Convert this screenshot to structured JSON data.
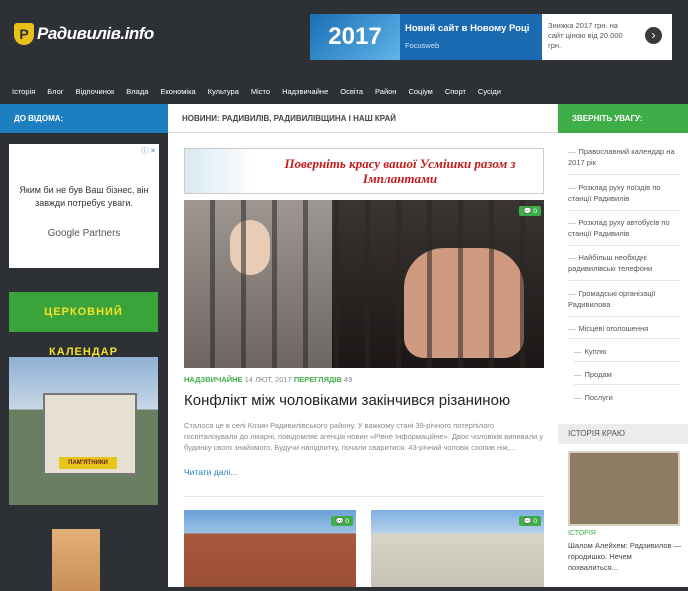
{
  "site": {
    "logo_letter": "Р",
    "logo_text": "Радивилів.info"
  },
  "top_ad": {
    "image_text": "2017",
    "title": "Новий сайт в Новому Році",
    "source": "Focusweb",
    "body": "Знижка 2017 грн. на сайт ціною від 20.000 грн.",
    "arrow": "›"
  },
  "nav": {
    "items": [
      "Історія",
      "Блог",
      "Відпочинок",
      "Влада",
      "Економіка",
      "Культура",
      "Місто",
      "Надзвичайне",
      "Освіта",
      "Район",
      "Соціум",
      "Спорт",
      "Сусіди"
    ]
  },
  "left": {
    "header": "ДО ВІДОМА:",
    "google_ad": {
      "text": "Яким би не був Ваш бізнес, він завжди потребує уваги.",
      "brand": "Google Partners",
      "close": "ⓘ ✕"
    },
    "calendar_banner": "ЦЕРКОВНИЙ КАЛЕНДАР",
    "kiosk_sign": "ПАМ'ЯТНИКИ"
  },
  "main": {
    "header": "НОВИНИ: РАДИВИЛІВ, РАДИВИЛІВЩИНА І НАШ КРАЙ",
    "banner_text": "Поверніть красу вашої Усмішки разом з Імплантами",
    "article": {
      "comments": "0",
      "category": "НАДЗВИЧАЙНЕ",
      "date": "14 ЛЮТ, 2017",
      "views_label": "ПЕРЕГЛЯДІВ",
      "views": "49",
      "title": "Конфлікт між чоловіками закінчився різаниною",
      "excerpt": "Сталося це в селі Козин Радивилівського району. У важкому стані 39-річного потерпілого госпіталізували до лікарні, повідомляє агенція новин «Рівне Інформаційне». Двоє чоловіків випивали у будинку свого знайомого. Будучи напідпитку, почали сваритися. 43-річний чоловік схопив ніж,...",
      "read_more": "Читати далі..."
    },
    "thumb_comments": [
      "0",
      "0"
    ]
  },
  "right": {
    "header": "ЗВЕРНІТЬ УВАГУ:",
    "links": [
      {
        "dash": "—",
        "text": "Православний календар на 2017 рік"
      },
      {
        "dash": "—",
        "text": "Розклад руху поїздів по станції Радивилів"
      },
      {
        "dash": "—",
        "text": "Розклад руху автобусів по станції Радивилів"
      },
      {
        "dash": "—",
        "text": "Найбільш необхідні радивилівські телефони"
      },
      {
        "dash": "—",
        "text": "Громадські організації Радивилова"
      },
      {
        "dash": "—",
        "text": "Місцеві оголошення"
      },
      {
        "dash": "—",
        "text": "Куплю"
      },
      {
        "dash": "—",
        "text": "Продам"
      },
      {
        "dash": "—",
        "text": "Послуги"
      }
    ],
    "history_header": "ІСТОРІЯ КРАЮ",
    "history_category": "ІСТОРІЯ",
    "history_text": "Шалом Алейхем: Радзивилов — городишко. Нечем похвалиться..."
  }
}
